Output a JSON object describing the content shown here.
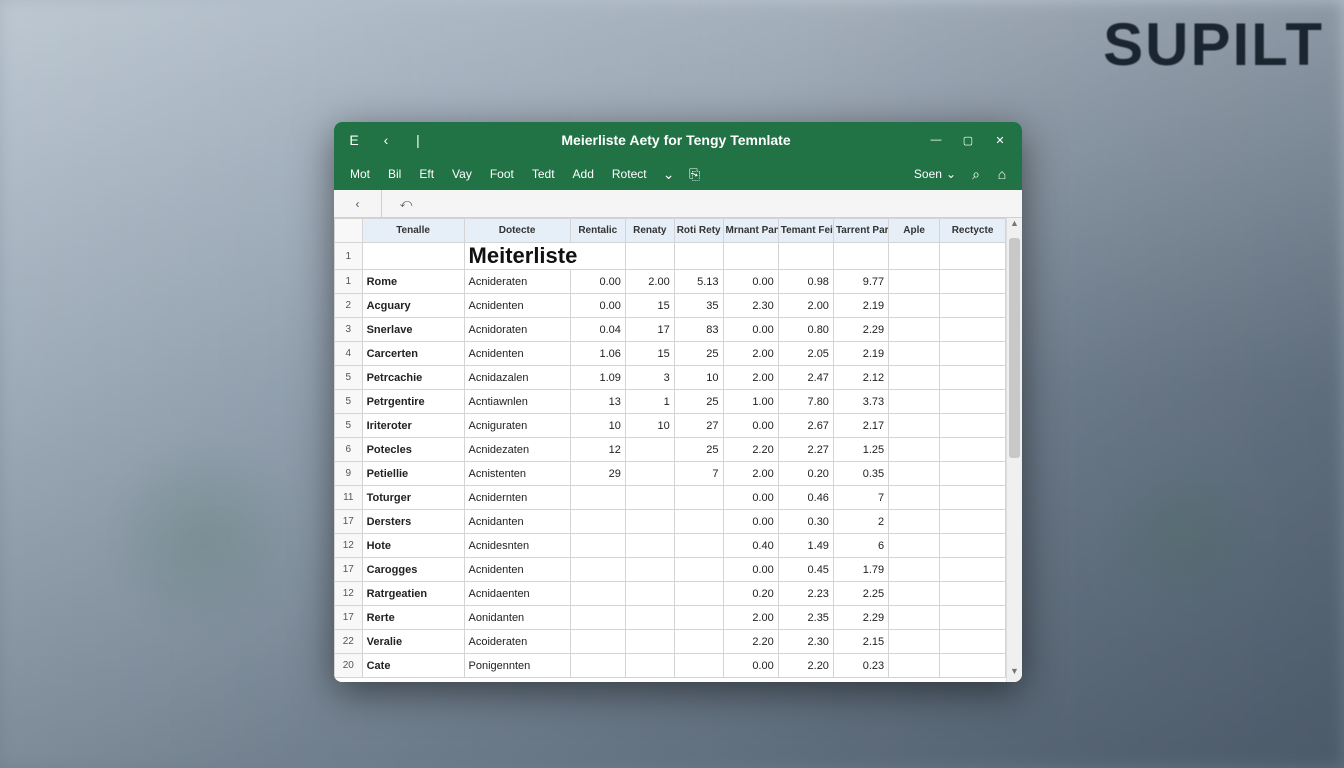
{
  "window": {
    "title": "Meierliste Aety for Tengy Temnlate"
  },
  "titlebar_icons": {
    "app": "E",
    "back": "‹",
    "fwd": "|"
  },
  "window_controls": {
    "min": "—",
    "max": "▢",
    "close": "✕"
  },
  "menu": {
    "items": [
      "Mot",
      "Bil",
      "Eft",
      "Vay",
      "Foot",
      "Tedt",
      "Add",
      "Rotect"
    ],
    "more": "⌄",
    "clip": "⎘",
    "share": "Soen",
    "share_caret": "⌄",
    "search": "⌕",
    "home": "⌂"
  },
  "nav": {
    "back": "‹",
    "fwd": "⤺"
  },
  "sheet": {
    "title": "Meiterliste",
    "title_rownum": "1",
    "headers": [
      "Tenalle",
      "Dotecte",
      "Rentalic",
      "Renaty",
      "Roti Rety",
      "Mrnant Pana",
      "Temant Feit/",
      "Tarrent Pary",
      "Aple",
      "Rectycte"
    ],
    "rows": [
      {
        "n": "1",
        "name": "Rome",
        "detect": "Acnideraten",
        "v": [
          "0.00",
          "2.00",
          "5.13",
          "0.00",
          "0.98",
          "9.77",
          "",
          ""
        ]
      },
      {
        "n": "2",
        "name": "Acguary",
        "detect": "Acnidenten",
        "v": [
          "0.00",
          "15",
          "35",
          "2.30",
          "2.00",
          "2.19",
          "",
          ""
        ]
      },
      {
        "n": "3",
        "name": "Snerlave",
        "detect": "Acnidoraten",
        "v": [
          "0.04",
          "17",
          "83",
          "0.00",
          "0.80",
          "2.29",
          "",
          ""
        ]
      },
      {
        "n": "4",
        "name": "Carcerten",
        "detect": "Acnidenten",
        "v": [
          "1.06",
          "15",
          "25",
          "2.00",
          "2.05",
          "2.19",
          "",
          ""
        ]
      },
      {
        "n": "5",
        "name": "Petrcachie",
        "detect": "Acnidazalen",
        "v": [
          "1.09",
          "3",
          "10",
          "2.00",
          "2.47",
          "2.12",
          "",
          ""
        ]
      },
      {
        "n": "5",
        "name": "Petrgentire",
        "detect": "Acntiawnlen",
        "v": [
          "13",
          "1",
          "25",
          "1.00",
          "7.80",
          "3.73",
          "",
          ""
        ]
      },
      {
        "n": "5",
        "name": "Iriteroter",
        "detect": "Acniguraten",
        "v": [
          "10",
          "10",
          "27",
          "0.00",
          "2.67",
          "2.17",
          "",
          ""
        ]
      },
      {
        "n": "6",
        "name": "Potecles",
        "detect": "Acnidezaten",
        "v": [
          "12",
          "",
          "25",
          "2.20",
          "2.27",
          "1.25",
          "",
          ""
        ]
      },
      {
        "n": "9",
        "name": "Petiellie",
        "detect": "Acnistenten",
        "v": [
          "29",
          "",
          "7",
          "2.00",
          "0.20",
          "0.35",
          "",
          ""
        ]
      },
      {
        "n": "11",
        "name": "Toturger",
        "detect": "Acnidernten",
        "v": [
          "",
          "",
          "",
          "0.00",
          "0.46",
          "7",
          "",
          ""
        ]
      },
      {
        "n": "17",
        "name": "Dersters",
        "detect": "Acnidanten",
        "v": [
          "",
          "",
          "",
          "0.00",
          "0.30",
          "2",
          "",
          ""
        ]
      },
      {
        "n": "12",
        "name": "Hote",
        "detect": "Acnidesnten",
        "v": [
          "",
          "",
          "",
          "0.40",
          "1.49",
          "6",
          "",
          ""
        ]
      },
      {
        "n": "17",
        "name": "Carogges",
        "detect": "Acnidenten",
        "v": [
          "",
          "",
          "",
          "0.00",
          "0.45",
          "1.79",
          "",
          ""
        ]
      },
      {
        "n": "12",
        "name": "Ratrgeatien",
        "detect": "Acnidaenten",
        "v": [
          "",
          "",
          "",
          "0.20",
          "2.23",
          "2.25",
          "",
          ""
        ]
      },
      {
        "n": "17",
        "name": "Rerte",
        "detect": "Aonidanten",
        "v": [
          "",
          "",
          "",
          "2.00",
          "2.35",
          "2.29",
          "",
          ""
        ]
      },
      {
        "n": "22",
        "name": "Veralie",
        "detect": "Acoideraten",
        "v": [
          "",
          "",
          "",
          "2.20",
          "2.30",
          "2.15",
          "",
          ""
        ]
      },
      {
        "n": "20",
        "name": "Cate",
        "detect": "Ponigennten",
        "v": [
          "",
          "",
          "",
          "0.00",
          "2.20",
          "0.23",
          "",
          ""
        ]
      }
    ]
  }
}
